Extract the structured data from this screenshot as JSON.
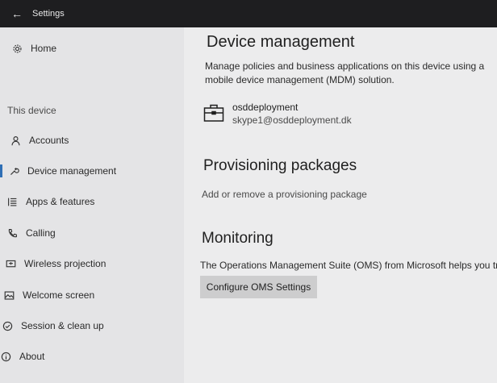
{
  "window": {
    "title": "Settings"
  },
  "sidebar": {
    "home": {
      "label": "Home",
      "icon": "gear-icon"
    },
    "section_label": "This device",
    "items": [
      {
        "label": "Accounts",
        "icon": "person-icon"
      },
      {
        "label": "Device management",
        "icon": "wrench-icon",
        "selected": true
      },
      {
        "label": "Apps & features",
        "icon": "list-icon"
      },
      {
        "label": "Calling",
        "icon": "phone-icon"
      },
      {
        "label": "Wireless projection",
        "icon": "projector-icon"
      },
      {
        "label": "Welcome screen",
        "icon": "image-icon"
      },
      {
        "label": "Session & clean up",
        "icon": "check-circle-icon"
      },
      {
        "label": "About",
        "icon": "info-icon"
      }
    ]
  },
  "main": {
    "device_management": {
      "title": "Device management",
      "description": "Manage policies and business applications on this device using a mobile device management (MDM) solution.",
      "account": {
        "name": "osddeployment",
        "email": "skype1@osddeployment.dk"
      }
    },
    "provisioning": {
      "title": "Provisioning packages",
      "link": "Add or remove a provisioning package"
    },
    "monitoring": {
      "title": "Monitoring",
      "description": "The Operations Management Suite (OMS) from Microsoft helps you tr",
      "button": "Configure OMS Settings"
    }
  },
  "colors": {
    "accent": "#2f6fb5",
    "titlebar": "#1e1e20",
    "background": "#e9e9ea"
  }
}
